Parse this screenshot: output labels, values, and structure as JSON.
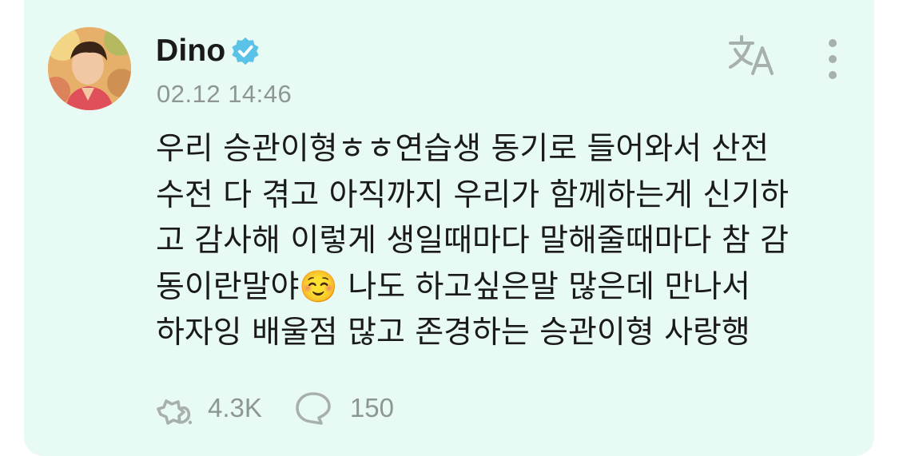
{
  "post": {
    "author_name": "Dino",
    "verified": true,
    "timestamp": "02.12 14:46",
    "text": "우리 승관이형ㅎㅎ연습생 동기로 들어와서 산전\n수전 다 겪고 아직까지 우리가 함께하는게 신기하\n고 감사해 이렇게 생일때마다 말해줄때마다 참 감\n동이란말야☺️ 나도 하고싶은말 많은데 만나서\n하자잉 배울점 많고 존경하는 승관이형 사랑행",
    "like_count": "4.3K",
    "comment_count": "150"
  },
  "icons": {
    "verified": "verified-badge-icon",
    "translate": "translate-icon",
    "more": "more-vertical-icon",
    "like": "reaction-icon",
    "comment": "comment-bubble-icon"
  },
  "colors": {
    "card_background": "#e8faf4",
    "verified_badge": "#5bc2e7",
    "muted_text": "#8e9693",
    "primary_text": "#1a1a1a"
  }
}
